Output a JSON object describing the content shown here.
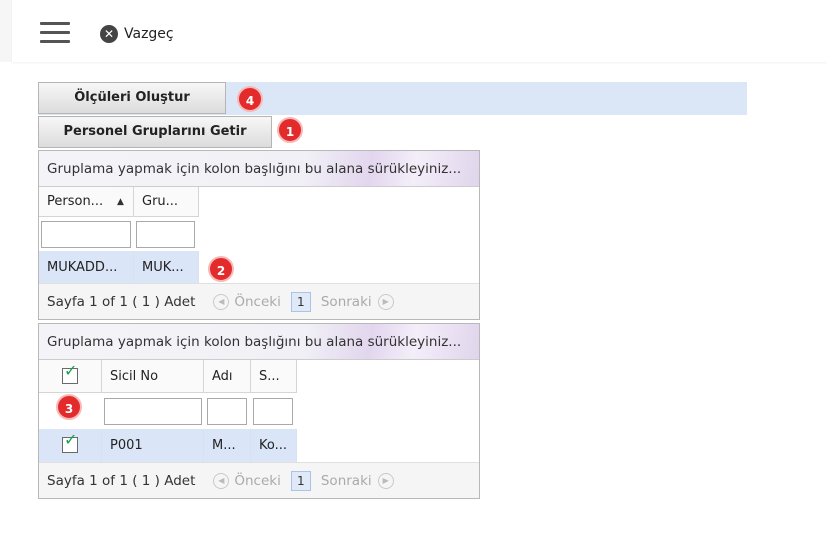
{
  "header": {
    "cancel_label": "Vazgeç"
  },
  "actions": {
    "create_measures_label": "Ölçüleri Oluştur",
    "get_groups_label": "Personel Gruplarını Getir"
  },
  "badges": [
    "4",
    "1",
    "2",
    "3"
  ],
  "grid1": {
    "group_hint": "Gruplama yapmak için kolon başlığını bu alana sürükleyiniz...",
    "columns": [
      "Person...",
      "Gru..."
    ],
    "rows": [
      [
        "MUKADD...",
        "MUK..."
      ]
    ],
    "pager": {
      "info": "Sayfa 1 of 1 ( 1 ) Adet",
      "prev": "Önceki",
      "page": "1",
      "next": "Sonraki"
    }
  },
  "grid2": {
    "group_hint": "Gruplama yapmak için kolon başlığını bu alana sürükleyiniz...",
    "columns": [
      "Sicil No",
      "Adı",
      "S..."
    ],
    "rows": [
      [
        "P001",
        "M...",
        "Ko..."
      ]
    ],
    "pager": {
      "info": "Sayfa 1 of 1 ( 1 ) Adet",
      "prev": "Önceki",
      "page": "1",
      "next": "Sonraki"
    }
  },
  "icons": {
    "cancel": "close-icon",
    "menu": "hamburger-menu-icon",
    "check": "check-icon",
    "sort": "sort-ascending-icon"
  },
  "colors": {
    "badge": "#e42b2b",
    "selected_row": "#dbe5f8",
    "band": "#dbe6f7"
  }
}
